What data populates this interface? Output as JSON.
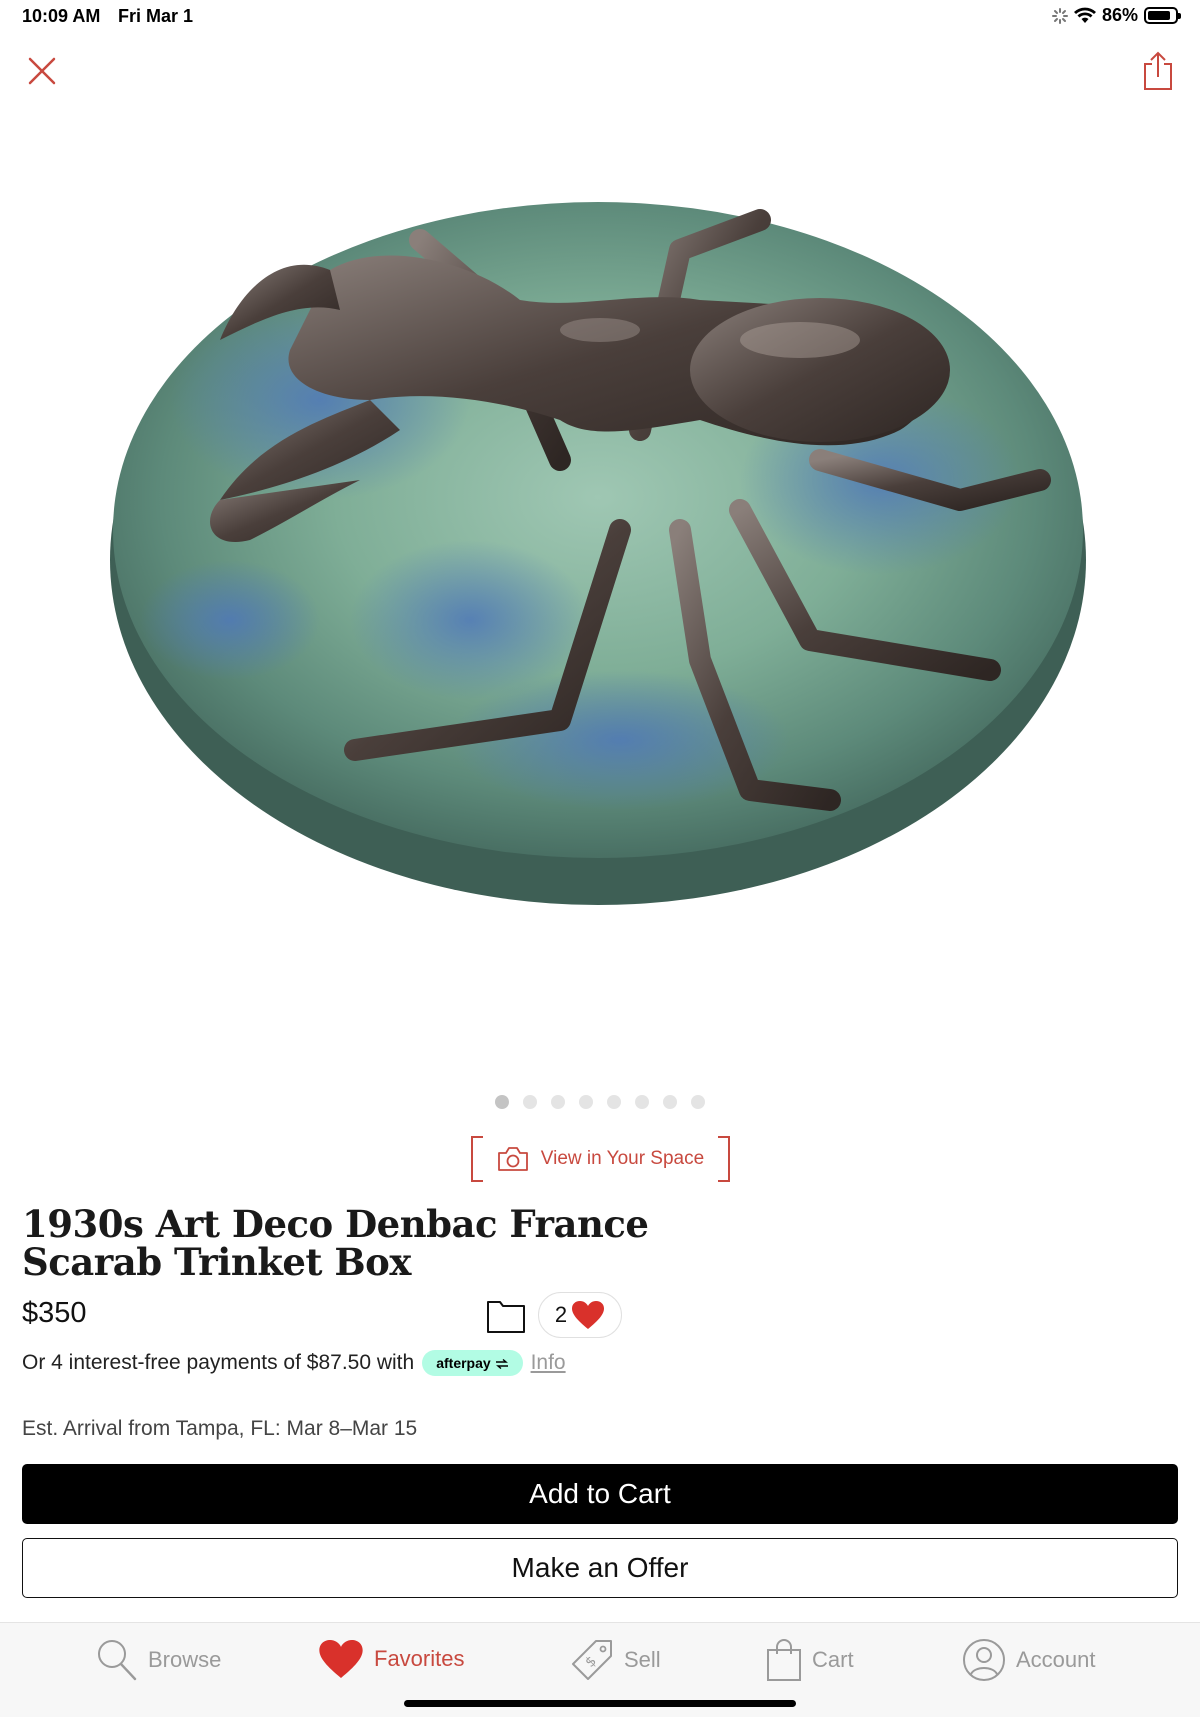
{
  "status": {
    "time": "10:09 AM",
    "date": "Fri Mar 1",
    "battery": "86%",
    "battery_level": 0.86
  },
  "carousel": {
    "count": 8,
    "active_index": 0
  },
  "view_in_space": {
    "label": "View in Your Space"
  },
  "product": {
    "title": "1930s Art Deco Denbac France Scarab Trinket Box",
    "price": "$350",
    "favorite_count": "2"
  },
  "payment": {
    "installments_text": "Or 4 interest-free payments of $87.50 with",
    "afterpay_label": "afterpay",
    "info_link": "Info"
  },
  "shipping": {
    "arrival": "Est. Arrival from Tampa, FL: Mar 8–Mar 15"
  },
  "actions": {
    "add_to_cart": "Add to Cart",
    "make_offer": "Make an Offer"
  },
  "tabs": [
    {
      "label": "Browse",
      "icon": "search-icon",
      "active": false
    },
    {
      "label": "Favorites",
      "icon": "heart-icon",
      "active": true
    },
    {
      "label": "Sell",
      "icon": "price-tag-icon",
      "active": false
    },
    {
      "label": "Cart",
      "icon": "shopping-bag-icon",
      "active": false
    },
    {
      "label": "Account",
      "icon": "person-icon",
      "active": false
    }
  ],
  "colors": {
    "accent": "#c8493f",
    "afterpay_mint": "#b2fce4",
    "primary_button": "#000000",
    "inactive_tab": "#9a9a9a"
  }
}
